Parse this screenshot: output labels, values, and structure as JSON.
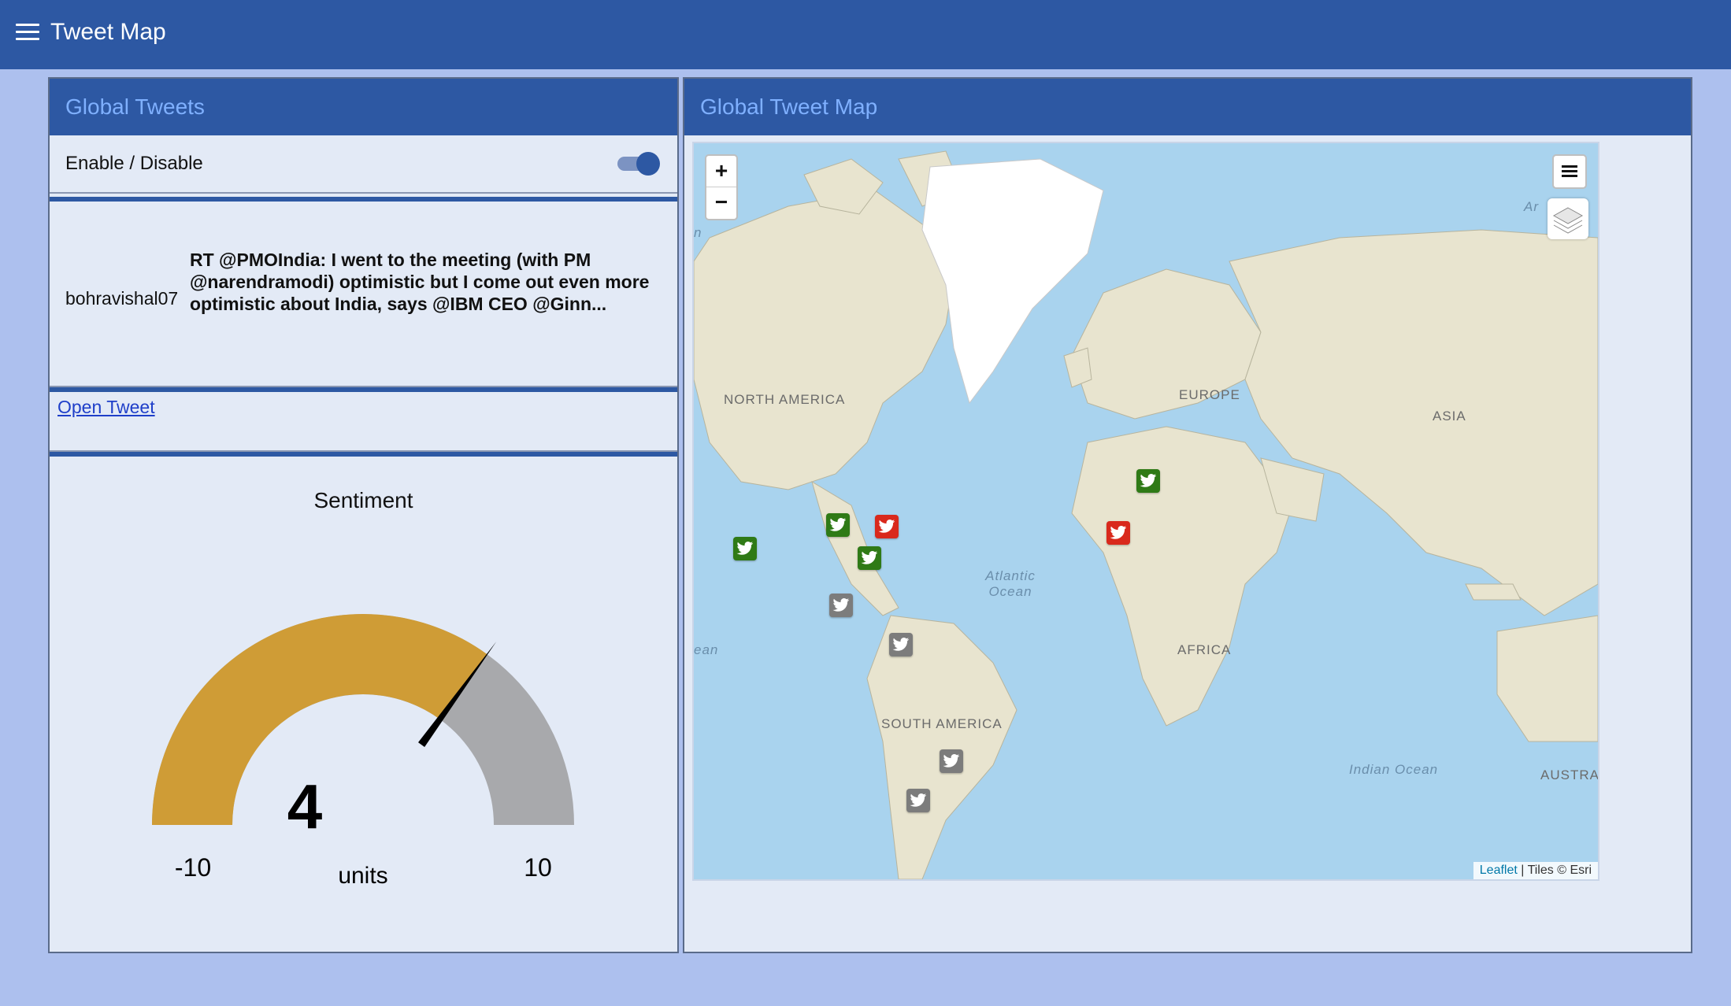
{
  "app": {
    "title": "Tweet Map"
  },
  "left_panel": {
    "header": "Global Tweets",
    "toggle_label": "Enable / Disable",
    "toggle_on": true,
    "tweet": {
      "user": "bohravishal07",
      "text": "RT @PMOIndia: I went to the meeting (with PM @narendramodi) optimistic but I come out even more optimistic about India, says @IBM CEO @Ginn..."
    },
    "open_tweet_label": "Open Tweet",
    "gauge": {
      "title": "Sentiment",
      "value": 4,
      "value_text": "4",
      "min": -10,
      "max": 10,
      "min_text": "-10",
      "max_text": "10",
      "units": "units",
      "fill_color": "#cf9c36",
      "rest_color": "#a8a9ac"
    }
  },
  "right_panel": {
    "header": "Global Tweet Map",
    "map": {
      "zoom_in": "+",
      "zoom_out": "−",
      "labels": {
        "north_america": "NORTH AMERICA",
        "south_america": "SOUTH AMERICA",
        "europe": "EUROPE",
        "asia": "ASIA",
        "africa": "AFRICA",
        "australia": "AUSTRA",
        "atlantic": "Atlantic Ocean",
        "indian": "Indian Ocean",
        "edge_left": "ean",
        "arctic": "Ar",
        "edge_n": "n"
      },
      "attribution_link": "Leaflet",
      "attribution_text": " | Tiles © Esri",
      "markers": [
        {
          "sentiment": "positive",
          "color": "#2f7a16",
          "icon": "twitter-bird-icon"
        },
        {
          "sentiment": "positive",
          "color": "#2f7a16",
          "icon": "twitter-bird-icon"
        },
        {
          "sentiment": "negative",
          "color": "#d9291c",
          "icon": "twitter-bird-icon"
        },
        {
          "sentiment": "positive",
          "color": "#2f7a16",
          "icon": "twitter-bird-icon"
        },
        {
          "sentiment": "neutral",
          "color": "#7c7c7c",
          "icon": "twitter-bird-icon"
        },
        {
          "sentiment": "neutral",
          "color": "#7c7c7c",
          "icon": "twitter-bird-icon"
        },
        {
          "sentiment": "neutral",
          "color": "#7c7c7c",
          "icon": "twitter-bird-icon"
        },
        {
          "sentiment": "neutral",
          "color": "#7c7c7c",
          "icon": "twitter-bird-icon"
        },
        {
          "sentiment": "positive",
          "color": "#2f7a16",
          "icon": "twitter-bird-icon"
        },
        {
          "sentiment": "negative",
          "color": "#d9291c",
          "icon": "twitter-bird-icon"
        }
      ]
    }
  }
}
